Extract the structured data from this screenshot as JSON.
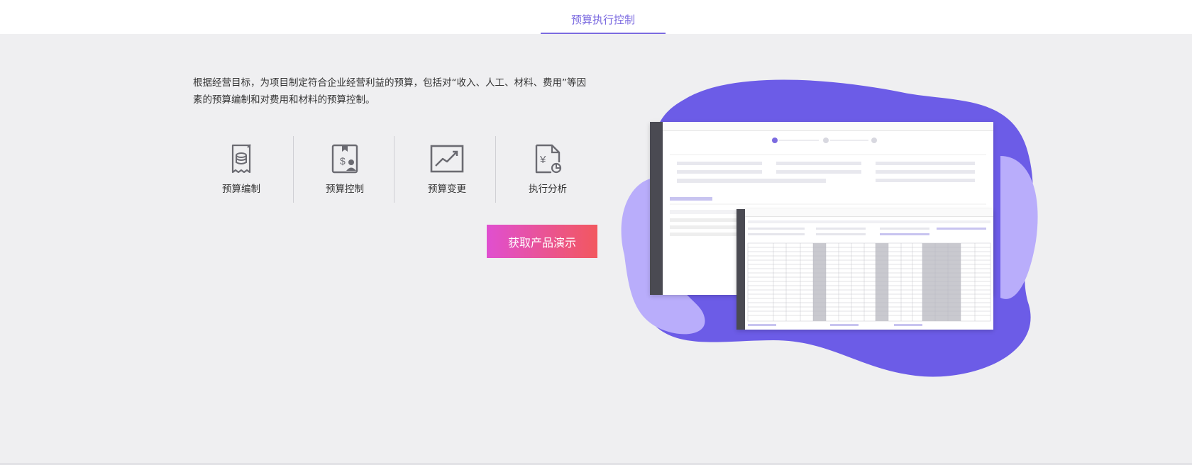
{
  "header": {
    "tab_label": "预算执行控制"
  },
  "description": "根据经营目标，为项目制定符合企业经营利益的预算，包括对“收入、人工、材料、费用”等因素的预算编制和对费用和材料的预算控制。",
  "features": [
    {
      "label": "预算编制",
      "icon": "budget-database-icon"
    },
    {
      "label": "预算控制",
      "icon": "budget-control-icon"
    },
    {
      "label": "预算变更",
      "icon": "trend-chart-icon"
    },
    {
      "label": "执行分析",
      "icon": "yuan-analysis-icon"
    }
  ],
  "cta": {
    "label": "获取产品演示"
  },
  "colors": {
    "accent": "#7b6ae0",
    "blob_dark": "#6c5ce7",
    "blob_light": "#b9adfb",
    "cta_start": "#e04fd0",
    "cta_end": "#f2585f"
  }
}
